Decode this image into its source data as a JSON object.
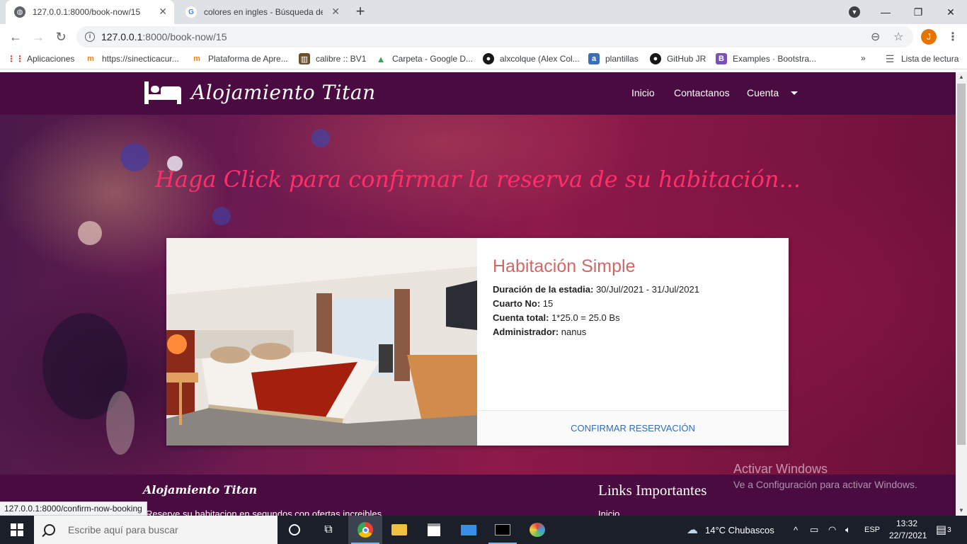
{
  "browser": {
    "tabs": [
      {
        "title": "127.0.0.1:8000/book-now/15",
        "active": true
      },
      {
        "title": "colores en ingles - Búsqueda de Google",
        "active": false
      }
    ],
    "url_host": "127.0.0.1",
    "url_rest": ":8000/book-now/15",
    "profile_initial": "J",
    "bookmarks": [
      {
        "label": "Aplicaciones",
        "icon": "apps-grid-icon"
      },
      {
        "label": "https://sinecticacur...",
        "icon": "moodle-icon"
      },
      {
        "label": "Plataforma de Apre...",
        "icon": "moodle-icon"
      },
      {
        "label": "calibre :: BV1",
        "icon": "calibre-icon"
      },
      {
        "label": "Carpeta - Google D...",
        "icon": "google-drive-icon"
      },
      {
        "label": "alxcolque (Alex Col...",
        "icon": "github-icon"
      },
      {
        "label": "plantillas",
        "icon": "a-icon"
      },
      {
        "label": "GitHub JR",
        "icon": "github-icon"
      },
      {
        "label": "Examples · Bootstra...",
        "icon": "bootstrap-icon"
      }
    ],
    "reading_list": "Lista de lectura",
    "status_url": "127.0.0.1:8000/confirm-now-booking"
  },
  "site": {
    "brand": "Alojamiento Titan",
    "nav": {
      "home": "Inicio",
      "contact": "Contactanos",
      "account": "Cuenta"
    },
    "hero_title": "Haga Click para confirmar la reserva de su habitación..."
  },
  "booking": {
    "room_type": "Habitación Simple",
    "stay_label": "Duración de la estadia:",
    "stay_value": "30/Jul/2021 - 31/Jul/2021",
    "room_no_label": "Cuarto No:",
    "room_no_value": "15",
    "total_label": "Cuenta total:",
    "total_value": "1*25.0 = 25.0 Bs",
    "admin_label": "Administrador:",
    "admin_value": "nanus",
    "confirm_button": "CONFIRMAR RESERVACIÓN"
  },
  "footer": {
    "brand": "Alojamiento Titan",
    "tagline": "Reserve su habitacion en segundos con ofertas increibles",
    "links_heading": "Links Importantes",
    "first_link": "Inicio"
  },
  "windows_activation": {
    "title": "Activar Windows",
    "subtitle": "Ve a Configuración para activar Windows."
  },
  "taskbar": {
    "search_placeholder": "Escribe aquí para buscar",
    "weather": "14°C  Chubascos",
    "language": "ESP",
    "time": "13:32",
    "date": "22/7/2021",
    "notifications": "3"
  },
  "colors": {
    "navbar": "#4a0c40",
    "hero_title": "#ff2e6a",
    "room_title": "#d06868",
    "confirm_link": "#2f6fb5"
  }
}
